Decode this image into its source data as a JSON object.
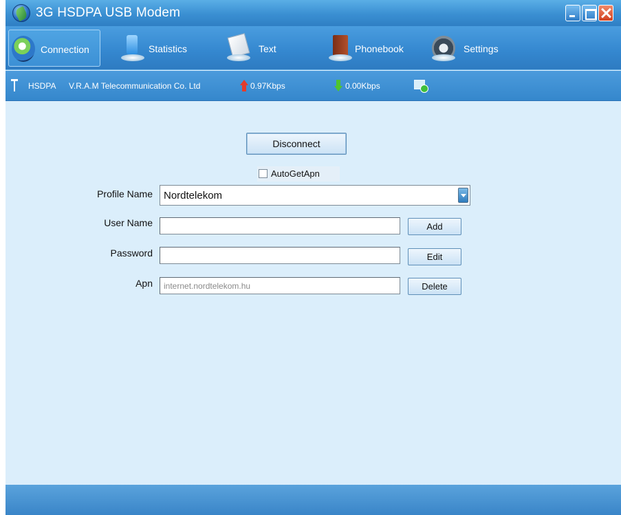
{
  "window": {
    "title": "3G HSDPA USB Modem"
  },
  "toolbar": {
    "items": [
      {
        "label": "Connection",
        "icon": "connection-icon",
        "active": true
      },
      {
        "label": "Statistics",
        "icon": "statistics-icon",
        "active": false
      },
      {
        "label": "Text",
        "icon": "text-icon",
        "active": false
      },
      {
        "label": "Phonebook",
        "icon": "phonebook-icon",
        "active": false
      },
      {
        "label": "Settings",
        "icon": "settings-icon",
        "active": false
      }
    ]
  },
  "status": {
    "network": "HSDPA",
    "operator": "V.R.A.M Telecommunication Co. Ltd",
    "upload_rate": "0.97Kbps",
    "download_rate": "0.00Kbps",
    "colors": {
      "upload": "#e43b2b",
      "download": "#4fc42f"
    }
  },
  "connection": {
    "disconnect_label": "Disconnect",
    "auto_get_apn_label": "AutoGetApn",
    "auto_get_apn_checked": false,
    "profile_name_label": "Profile Name",
    "profile_name_value": "Nordtelekom",
    "user_name_label": "User Name",
    "user_name_value": "",
    "password_label": "Password",
    "password_value": "",
    "apn_label": "Apn",
    "apn_value": "internet.nordtelekom.hu",
    "add_label": "Add",
    "edit_label": "Edit",
    "delete_label": "Delete"
  }
}
